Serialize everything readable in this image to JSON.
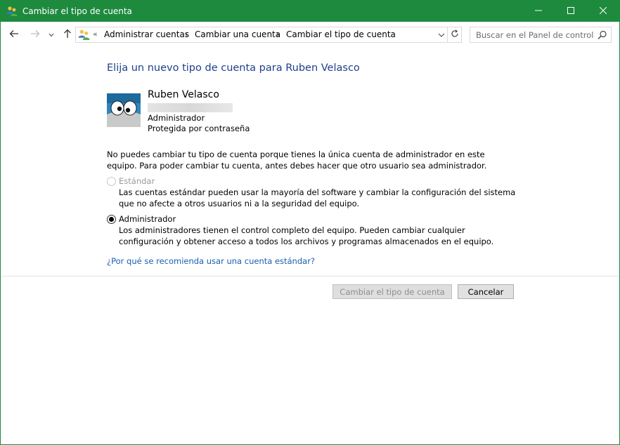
{
  "window": {
    "title": "Cambiar el tipo de cuenta",
    "controls": {
      "minimize": "minimize-icon",
      "maximize": "maximize-icon",
      "close": "close-icon"
    }
  },
  "colors": {
    "titlebar": "#1e8a3e",
    "heading": "#1e3f8a",
    "link": "#1a5fb4"
  },
  "nav": {
    "overflow": "«",
    "breadcrumbs": [
      "Administrar cuentas",
      "Cambiar una cuenta",
      "Cambiar el tipo de cuenta"
    ],
    "search_placeholder": "Buscar en el Panel de control"
  },
  "page": {
    "heading": "Elija un nuevo tipo de cuenta para Ruben Velasco",
    "user": {
      "name": "Ruben Velasco",
      "role": "Administrador",
      "protection": "Protegida por contraseña"
    },
    "notice": "No puedes cambiar tu tipo de cuenta porque tienes la única cuenta de administrador en este equipo. Para poder cambiar tu cuenta, antes debes hacer que otro usuario sea administrador.",
    "options": [
      {
        "label": "Estándar",
        "description": "Las cuentas estándar pueden usar la mayoría del software y cambiar la configuración del sistema que no afecte a otros usuarios ni a la seguridad del equipo.",
        "checked": false,
        "disabled": true
      },
      {
        "label": "Administrador",
        "description": "Los administradores tienen el control completo del equipo. Pueden cambiar cualquier configuración y obtener acceso a todos los archivos y programas almacenados en el equipo.",
        "checked": true,
        "disabled": false
      }
    ],
    "help_link": "¿Por qué se recomienda usar una cuenta estándar?",
    "buttons": {
      "change": "Cambiar el tipo de cuenta",
      "cancel": "Cancelar"
    }
  }
}
